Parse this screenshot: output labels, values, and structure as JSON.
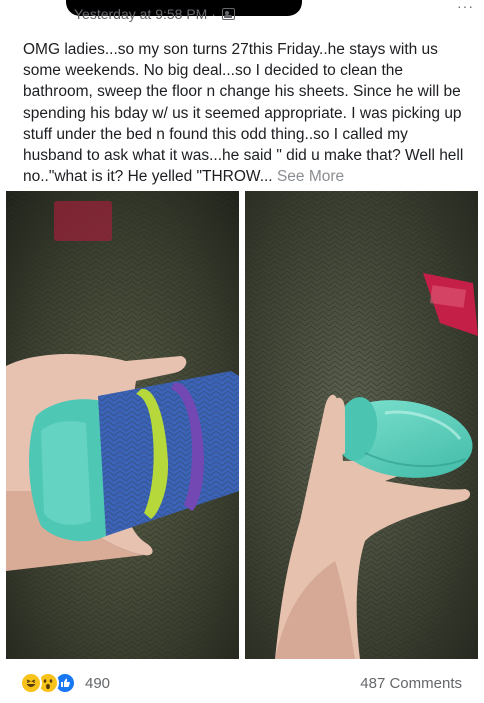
{
  "post": {
    "timestamp": "Yesterday at 9:58 PM ·",
    "privacy_icon": "friends-icon",
    "text": "OMG ladies...so my son turns 27this Friday..he stays with us some weekends. No big deal...so I decided to clean the bathroom, sweep the floor n change his sheets. Since he will be spending his bday w/ us it seemed appropriate. I was picking up stuff under the bed n found this odd thing..so I called my husband to ask what it was...he said \" did u make that? Well hell no..\"what is it? He yelled \"THROW...",
    "see_more": "See More"
  },
  "photos": [
    {
      "id": "photo-left",
      "description_icon": "hand-holding-object"
    },
    {
      "id": "photo-right",
      "description_icon": "hand-holding-object"
    }
  ],
  "footer": {
    "reactions": [
      "haha",
      "wow",
      "like"
    ],
    "reaction_count": "490",
    "comments": "487 Comments"
  },
  "colors": {
    "text": "#1c1e21",
    "secondary": "#65676b",
    "see_more": "#8a8d91",
    "like_blue": "#1877f2",
    "emoji_yellow": "#f7c31b"
  }
}
